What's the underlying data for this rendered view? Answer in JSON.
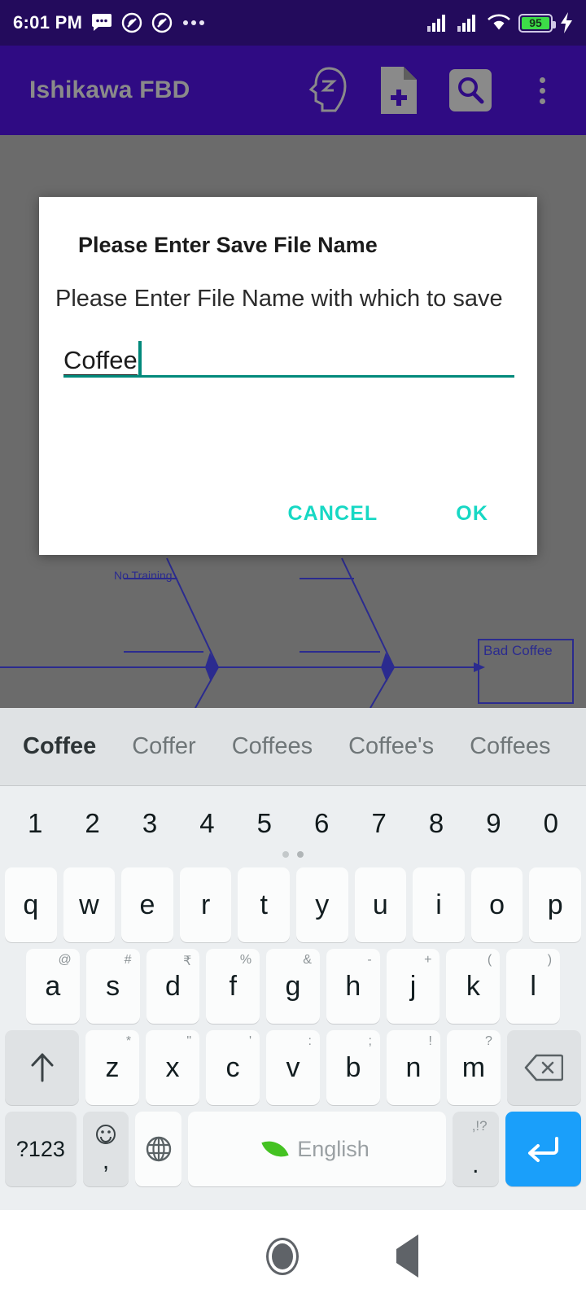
{
  "status_bar": {
    "time": "6:01 PM",
    "battery_percent": "95",
    "icons": [
      "message-icon",
      "do-not-disturb-icon",
      "do-not-disturb-icon",
      "more-dots-icon",
      "signal-icon",
      "signal-icon",
      "wifi-icon",
      "battery-icon",
      "charging-bolt-icon"
    ],
    "bg_color": "#230b5c"
  },
  "app_bar": {
    "title": "Ishikawa FBD",
    "bg_color": "#2f0b83",
    "title_color": "#8a8a8a",
    "actions": [
      {
        "name": "mindmap-head-icon"
      },
      {
        "name": "new-file-icon"
      },
      {
        "name": "search-icon"
      },
      {
        "name": "overflow-menu-icon"
      }
    ]
  },
  "canvas": {
    "bg_color": "#6b6b6b",
    "line_color": "#2b2b8f",
    "labels": [
      {
        "text": "No Training"
      },
      {
        "text": "Bad Coffee"
      }
    ]
  },
  "dialog": {
    "title": "Please Enter Save File Name",
    "message": "Please Enter File Name with which to save",
    "input_value": "Coffee",
    "input_placeholder": "",
    "accent_color": "#00897b",
    "button_color": "#17d8c4",
    "buttons": [
      {
        "label": "CANCEL"
      },
      {
        "label": "OK"
      }
    ]
  },
  "keyboard": {
    "suggestions": [
      "Coffee",
      "Coffer",
      "Coffees",
      "Coffee's",
      "Coffees"
    ],
    "number_row": [
      "1",
      "2",
      "3",
      "4",
      "5",
      "6",
      "7",
      "8",
      "9",
      "0"
    ],
    "row1": [
      {
        "main": "q"
      },
      {
        "main": "w"
      },
      {
        "main": "e"
      },
      {
        "main": "r"
      },
      {
        "main": "t"
      },
      {
        "main": "y"
      },
      {
        "main": "u"
      },
      {
        "main": "i"
      },
      {
        "main": "o"
      },
      {
        "main": "p"
      }
    ],
    "row2": [
      {
        "main": "a",
        "sub": "@"
      },
      {
        "main": "s",
        "sub": "#"
      },
      {
        "main": "d",
        "sub": "₹"
      },
      {
        "main": "f",
        "sub": "%"
      },
      {
        "main": "g",
        "sub": "&"
      },
      {
        "main": "h",
        "sub": "-"
      },
      {
        "main": "j",
        "sub": "+"
      },
      {
        "main": "k",
        "sub": "("
      },
      {
        "main": "l",
        "sub": ")"
      }
    ],
    "row3": [
      {
        "main": "z",
        "sub": "*"
      },
      {
        "main": "x",
        "sub": "\""
      },
      {
        "main": "c",
        "sub": "'"
      },
      {
        "main": "v",
        "sub": ":"
      },
      {
        "main": "b",
        "sub": ";"
      },
      {
        "main": "n",
        "sub": "!"
      },
      {
        "main": "m",
        "sub": "?"
      }
    ],
    "shift_key": "shift-key",
    "backspace_key": "backspace-key",
    "symbols_key_label": "?123",
    "comma_key_label": ",",
    "space_key_label": "English",
    "period_key_label": ".",
    "period_key_sub": ",!?",
    "enter_key": "enter-key",
    "enter_key_color": "#1a9ffa",
    "bg_color": "#eceff1"
  },
  "nav_bar": {
    "buttons": [
      "recents-button",
      "home-button",
      "back-button"
    ],
    "bg_color": "#ffffff"
  }
}
